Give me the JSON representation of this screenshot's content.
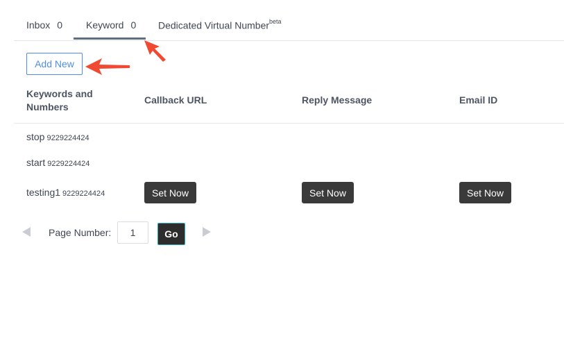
{
  "tabs": [
    {
      "label": "Inbox",
      "count": "0"
    },
    {
      "label": "Keyword",
      "count": "0",
      "active": true
    },
    {
      "label": "Dedicated Virtual Number",
      "sup": "beta"
    }
  ],
  "add_new_label": "Add New",
  "table": {
    "headers": {
      "keywords": "Keywords and Numbers",
      "callback": "Callback URL",
      "reply": "Reply Message",
      "email": "Email ID"
    },
    "rows": [
      {
        "keyword": "stop",
        "number": "9229224424"
      },
      {
        "keyword": "start",
        "number": "9229224424"
      },
      {
        "keyword": "testing1",
        "number": "9229224424"
      }
    ],
    "set_now_label": "Set Now"
  },
  "pagination": {
    "label": "Page Number:",
    "value": "1",
    "go_label": "Go"
  },
  "colors": {
    "accent": "#4f8de0",
    "dark_button": "#3a3a3a",
    "annotation_arrow": "#f04a33"
  },
  "icons": {
    "prev": "triangle-left-icon",
    "next": "triangle-right-icon",
    "annotation": "red-arrow-icon"
  }
}
